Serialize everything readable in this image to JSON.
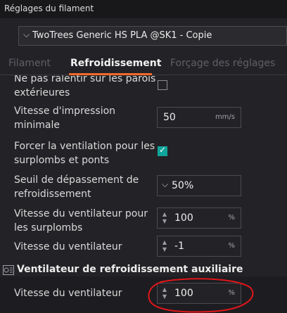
{
  "window": {
    "title": "Réglages du filament"
  },
  "preset": {
    "value": "TwoTrees Generic HS PLA @SK1 - Copie"
  },
  "tabs": [
    {
      "label": "Filament"
    },
    {
      "label": "Refroidissement"
    },
    {
      "label": "Forçage des réglages"
    }
  ],
  "settings": {
    "dont_slow_outer_walls": {
      "label_line1": "Ne pas ralentir sur les parois",
      "label_line2": "extérieures",
      "checked": false
    },
    "min_print_speed": {
      "label_line1": "Vitesse d'impression",
      "label_line2": "minimale",
      "value": "50",
      "unit": "mm/s"
    },
    "force_cooling_overhangs": {
      "label_line1": "Forcer la ventilation pour les",
      "label_line2": "surplombs et ponts",
      "checked": true
    },
    "cooling_overhang_threshold": {
      "label_line1": "Seuil de dépassement de",
      "label_line2": "refroidissement",
      "value": "50%"
    },
    "overhang_fan_speed": {
      "label_line1": "Vitesse du ventilateur pour",
      "label_line2": "les surplombs",
      "value": "100",
      "unit": "%"
    },
    "fan_speed": {
      "label": "Vitesse du ventilateur",
      "value": "-1",
      "unit": "%"
    }
  },
  "aux_fan_section": {
    "title": "Ventilateur de refroidissement auxiliaire",
    "icon": "fan-section-icon",
    "fan_speed": {
      "label": "Vitesse du ventilateur",
      "value": "100",
      "unit": "%"
    }
  },
  "colors": {
    "accent": "#f26a2b",
    "checkbox": "#10a59a",
    "annotation": "#e0161b"
  }
}
